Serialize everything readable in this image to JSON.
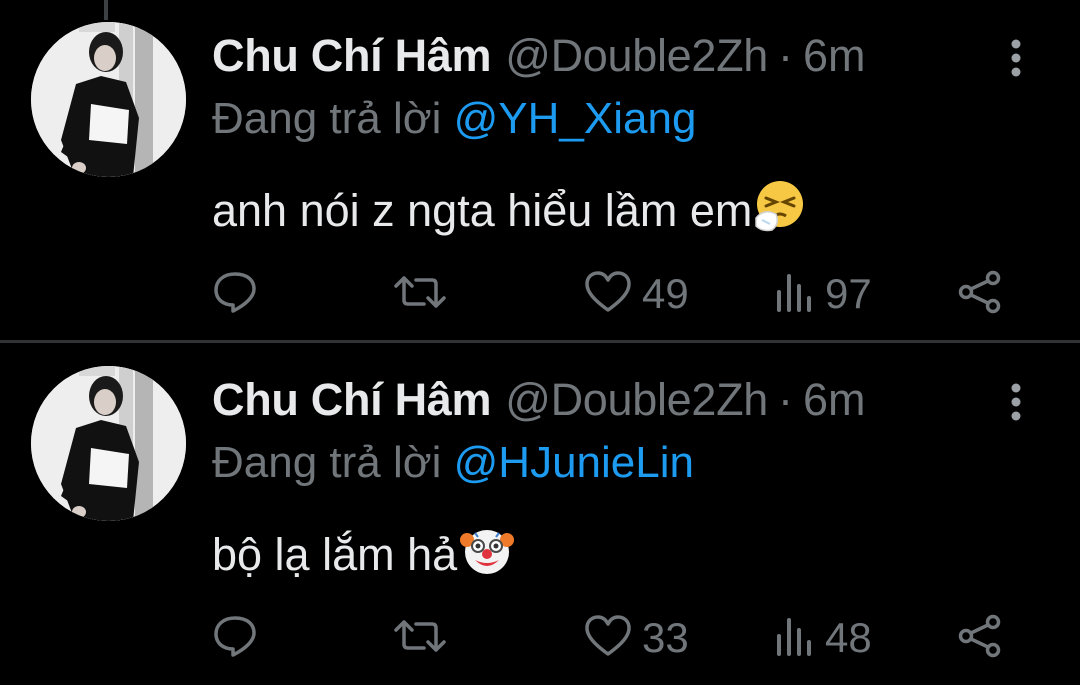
{
  "tweets": [
    {
      "name": "Chu Chí Hâm",
      "handle": "@Double2Zh",
      "separator": "·",
      "time": "6m",
      "replying_prefix": "Đang trả lời",
      "replying_to": "@YH_Xiang",
      "text": "anh nói z ngta hiểu lầm em",
      "emoji": "sneezing-face",
      "likes": "49",
      "views": "97"
    },
    {
      "name": "Chu Chí Hâm",
      "handle": "@Double2Zh",
      "separator": "·",
      "time": "6m",
      "replying_prefix": "Đang trả lời",
      "replying_to": "@HJunieLin",
      "text": "bộ lạ lắm hả",
      "emoji": "clown-face",
      "likes": "33",
      "views": "48"
    }
  ],
  "colors": {
    "background": "#000000",
    "text": "#e7e9ea",
    "muted": "#71767b",
    "accent": "#1d9bf0",
    "divider": "#2f3336"
  }
}
